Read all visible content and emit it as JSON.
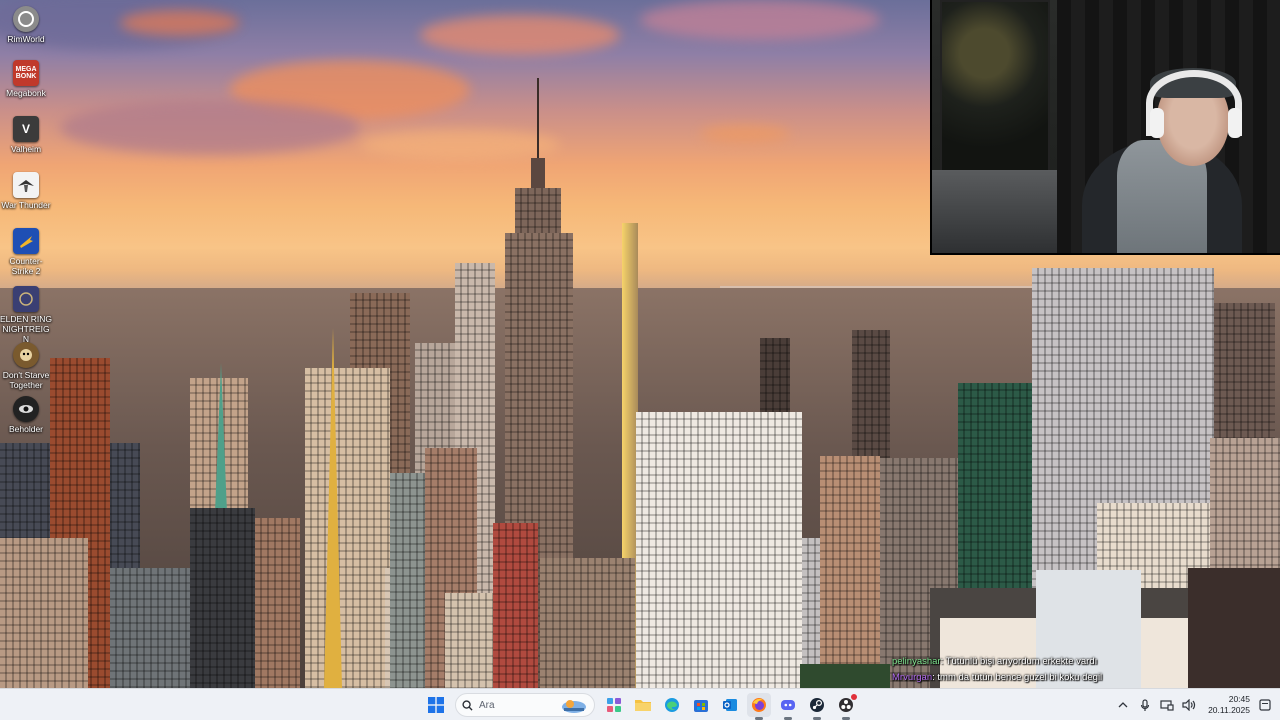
{
  "desktop": {
    "icons": [
      {
        "label": "RimWorld",
        "icon": "rimworld-icon",
        "color": "#8b8b8b"
      },
      {
        "label": "Megabonk",
        "icon": "megabonk-icon",
        "color": "#c0392b",
        "glyph": "MEGA BONK"
      },
      {
        "label": "Valheim",
        "icon": "valheim-icon",
        "color": "#3b3b3b",
        "glyph": "V"
      },
      {
        "label": "War Thunder",
        "icon": "war-thunder-icon",
        "color": "#ffffff"
      },
      {
        "label": "Counter-Strike 2",
        "icon": "counter-strike-2-icon",
        "color": "#1f4fb4"
      },
      {
        "label": "ELDEN RING NIGHTREIGN",
        "icon": "elden-ring-nightreign-icon",
        "color": "#3a3f73"
      },
      {
        "label": "Don't Starve Together",
        "icon": "dont-starve-together-icon",
        "color": "#7a5a2e"
      },
      {
        "label": "Beholder",
        "icon": "beholder-icon",
        "color": "#222222"
      }
    ]
  },
  "chat": {
    "messages": [
      {
        "user": "pelinyashar",
        "user_color": "#7fe38f",
        "text": ": Tütünlü bişi arıyordum erkekte vardı"
      },
      {
        "user": "Mrvurgan",
        "user_color": "#b36cf0",
        "text": ": tmm da tütün bence guzel bi koku degil"
      }
    ]
  },
  "taskbar": {
    "search_placeholder": "Ara",
    "apps": [
      {
        "name": "widgets-icon"
      },
      {
        "name": "file-explorer-icon"
      },
      {
        "name": "edge-icon"
      },
      {
        "name": "microsoft-store-icon"
      },
      {
        "name": "outlook-icon"
      },
      {
        "name": "firefox-icon"
      },
      {
        "name": "discord-icon"
      },
      {
        "name": "steam-icon"
      },
      {
        "name": "obs-icon"
      }
    ],
    "clock": {
      "time": "20:45",
      "date": "20.11.2025"
    }
  },
  "colors": {
    "taskbar_bg": "#eef1f6",
    "windows_accent": "#1e73e8"
  }
}
